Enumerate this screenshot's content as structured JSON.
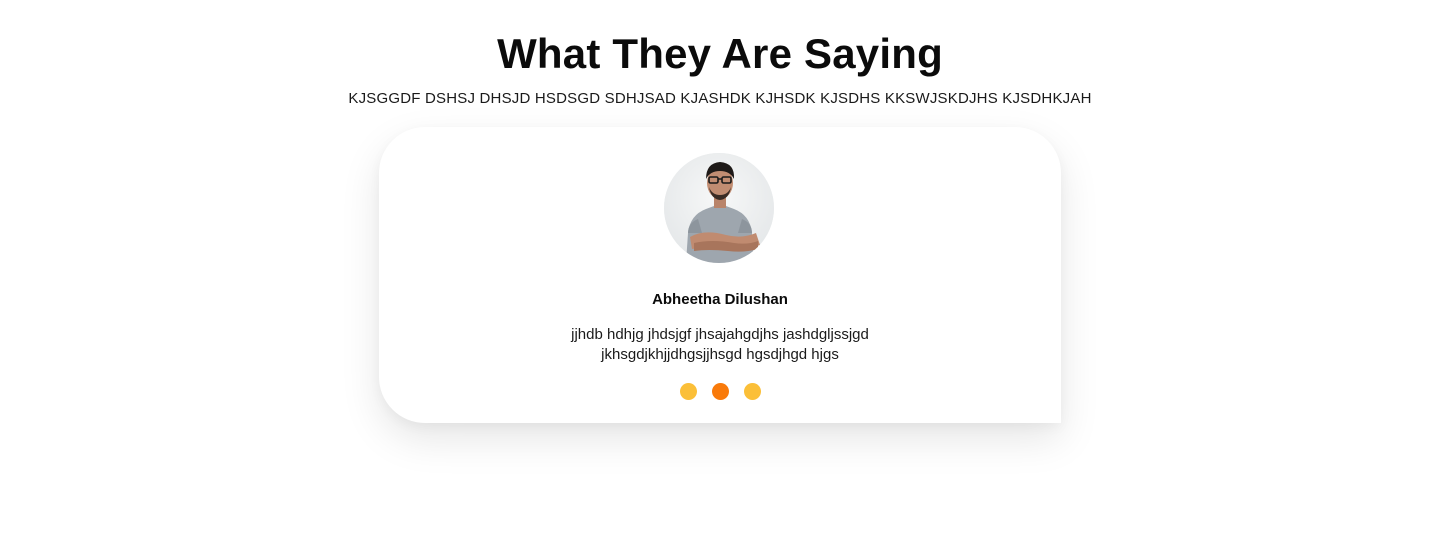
{
  "section": {
    "title": "What They Are Saying",
    "subtitle": "KJSGGDF DSHSJ DHSJD HSDSGD SDHJSAD KJASHDK KJHSDK KJSDHS KKSWJSKDJHS KJSDHKJAH"
  },
  "testimonial": {
    "name": "Abheetha Dilushan",
    "quote_line_1": "jjhdb hdhjg jhdsjgf jhsajahgdjhs jashdgljssjgd",
    "quote_line_2": "jkhsgdjkhjjdhgsjjhsgd hgsdjhgd hjgs"
  },
  "carousel": {
    "dots": 3,
    "active_index": 1
  },
  "colors": {
    "dot_inactive": "#fbbf38",
    "dot_active": "#f97a0a"
  }
}
